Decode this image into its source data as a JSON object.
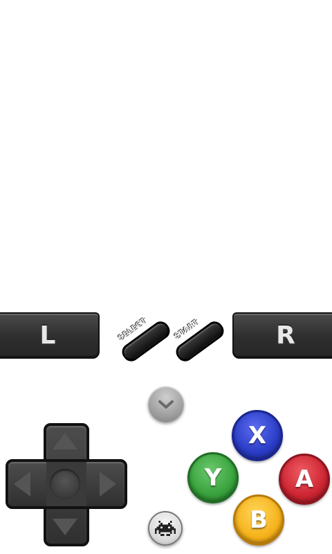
{
  "controller": {
    "shoulder_left_label": "L",
    "shoulder_right_label": "R",
    "select_label": "SELECT",
    "start_label": "START",
    "face_buttons": {
      "x": "X",
      "y": "Y",
      "a": "A",
      "b": "B"
    },
    "menu_toggle_icon": "chevron-down-icon",
    "emulator_menu_icon": "space-invader-icon"
  },
  "colors": {
    "x_button": "#2a3cc6",
    "y_button": "#38a23c",
    "a_button": "#cc2431",
    "b_button": "#f5b21a"
  }
}
